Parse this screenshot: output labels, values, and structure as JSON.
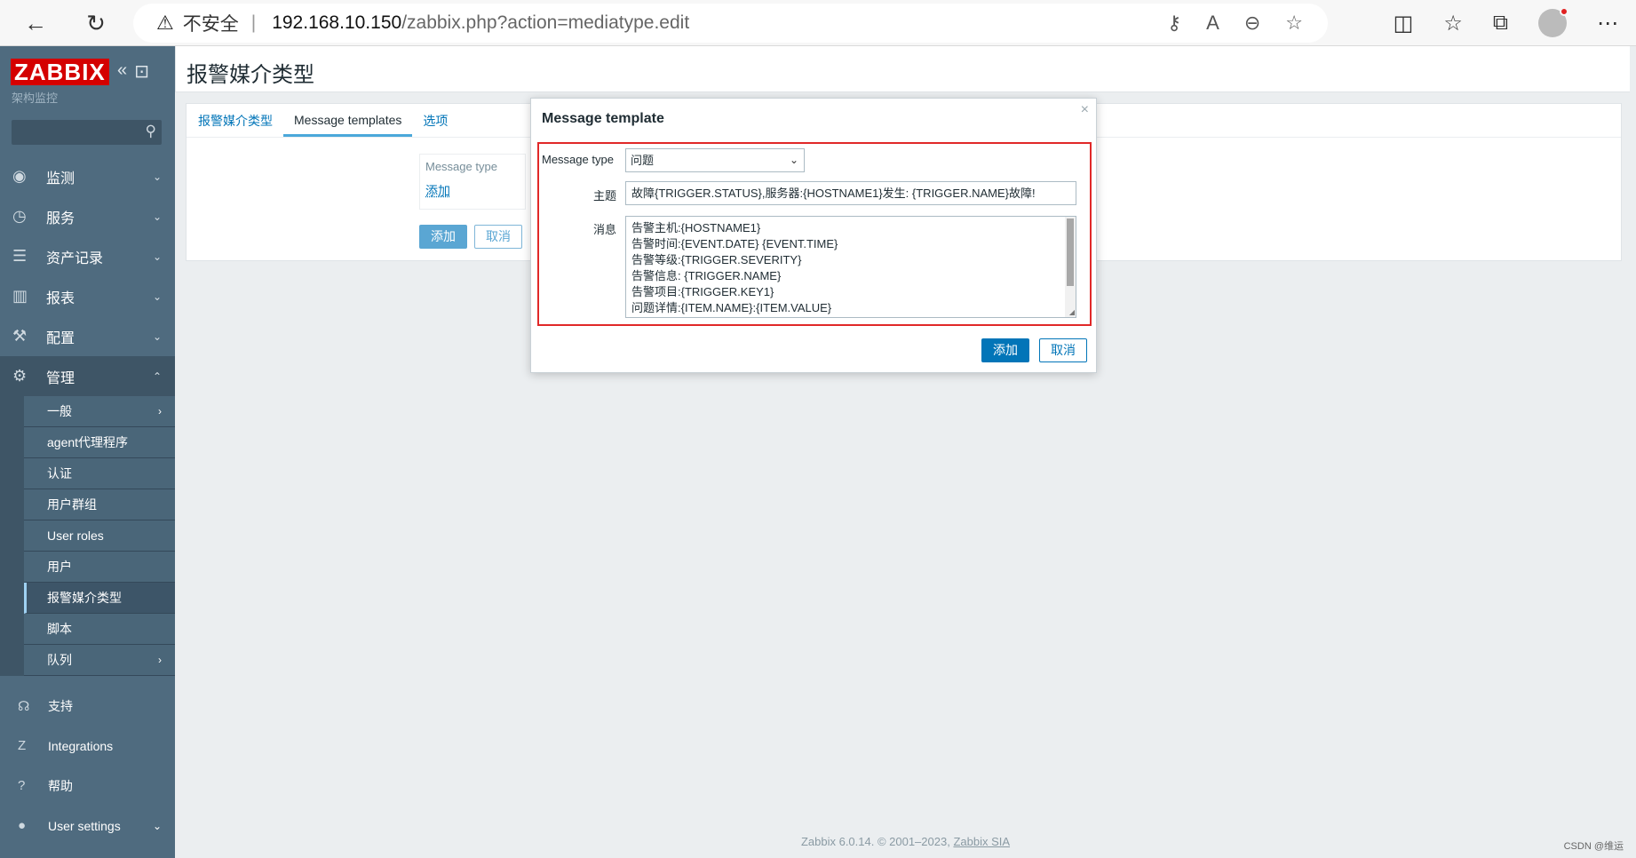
{
  "browser": {
    "back_glyph": "←",
    "reload_glyph": "↻",
    "warn_glyph": "⚠",
    "insecure_label": "不安全",
    "separator": "|",
    "url_host": "192.168.10.150",
    "url_path": "/zabbix.php?action=mediatype.edit"
  },
  "sidebar": {
    "logo": "ZABBIX",
    "subtitle": "架构监控",
    "menu": [
      {
        "label": "监测",
        "icon": "eye-icon"
      },
      {
        "label": "服务",
        "icon": "clock-icon"
      },
      {
        "label": "资产记录",
        "icon": "list-icon"
      },
      {
        "label": "报表",
        "icon": "chart-icon"
      },
      {
        "label": "配置",
        "icon": "wrench-icon"
      },
      {
        "label": "管理",
        "icon": "gear-icon"
      }
    ],
    "submenu": [
      {
        "label": "一般"
      },
      {
        "label": "agent代理程序"
      },
      {
        "label": "认证"
      },
      {
        "label": "用户群组"
      },
      {
        "label": "User roles"
      },
      {
        "label": "用户"
      },
      {
        "label": "报警媒介类型"
      },
      {
        "label": "脚本"
      },
      {
        "label": "队列"
      }
    ],
    "bottom": [
      {
        "label": "支持"
      },
      {
        "label": "Integrations"
      },
      {
        "label": "帮助"
      },
      {
        "label": "User settings"
      }
    ]
  },
  "page": {
    "title": "报警媒介类型",
    "tabs": [
      "报警媒介类型",
      "Message templates",
      "选项"
    ],
    "table_header": "Message type",
    "add_link": "添加",
    "add_button": "添加",
    "cancel_button": "取消"
  },
  "modal": {
    "title": "Message template",
    "close": "×",
    "message_type_label": "Message type",
    "message_type_value": "问题",
    "subject_label": "主题",
    "subject_value": "故障{TRIGGER.STATUS},服务器:{HOSTNAME1}发生: {TRIGGER.NAME}故障!",
    "message_label": "消息",
    "message_lines": [
      "告警主机:{HOSTNAME1}",
      "告警时间:{EVENT.DATE} {EVENT.TIME}",
      "告警等级:{TRIGGER.SEVERITY}",
      "告警信息: {TRIGGER.NAME}",
      "告警项目:{TRIGGER.KEY1}",
      "问题详情:{ITEM.NAME}:{ITEM.VALUE}"
    ],
    "add_button": "添加",
    "cancel_button": "取消"
  },
  "footer": {
    "text": "Zabbix 6.0.14. © 2001–2023, ",
    "link": "Zabbix SIA"
  },
  "watermark": "CSDN @维运",
  "colors": {
    "sidebar_bg": "#4f6b7f",
    "logo_red": "#d40000",
    "primary_blue": "#0275b8",
    "highlight_red": "#e02828"
  }
}
